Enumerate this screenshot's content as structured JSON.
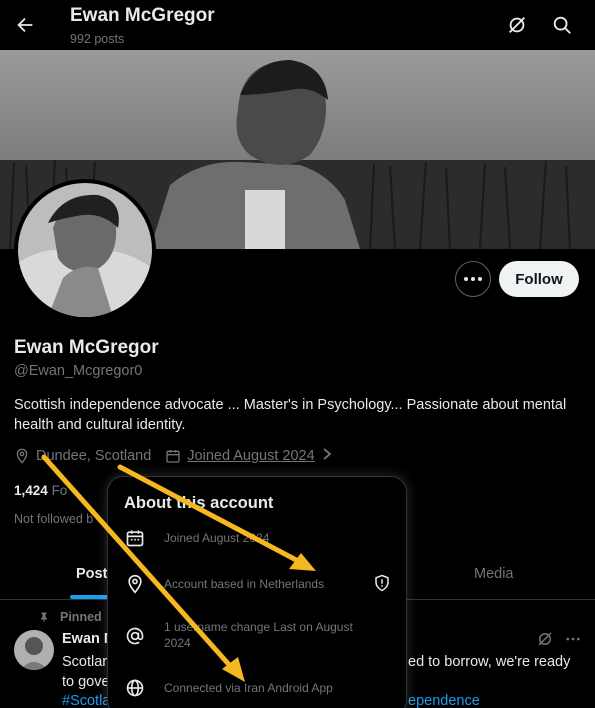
{
  "header": {
    "title": "Ewan McGregor",
    "post_count": "992 posts"
  },
  "profile": {
    "name": "Ewan McGregor",
    "handle": "@Ewan_Mcgregor0",
    "bio_line1": "Scottish independence advocate ... Master's in Psychology... Passionate about mental",
    "bio_line2": "health and cultural identity.",
    "location": "Dundee, Scotland",
    "joined": "Joined August 2024",
    "following_count": "1,424",
    "following_label_partial": "Fo",
    "followed_by_partial": "Not followed b",
    "follow_label": "Follow"
  },
  "tabs": {
    "posts_partial": "Post",
    "media": "Media"
  },
  "post": {
    "pinned_partial": "Pinned",
    "name_partial": "Ewan M",
    "line1_left": "Scotlar",
    "line1_right": "ed to borrow, we're ready",
    "line2_left": "to gove",
    "line3_left": "#Scotla",
    "line3_right": "ependence"
  },
  "about_popover": {
    "title": "About this account",
    "items": [
      {
        "icon": "calendar-icon",
        "text": "Joined August 2024"
      },
      {
        "icon": "location-icon",
        "text": "Account based in Netherlands"
      },
      {
        "icon": "at-icon",
        "text_line1": "1 username change Last on August",
        "text_line2": "2024"
      },
      {
        "icon": "globe-icon",
        "text": "Connected via Iran Android App"
      }
    ]
  },
  "colors": {
    "accent": "#1d9bf0",
    "annotation_arrow": "#f5b820",
    "muted": "#71767b"
  }
}
